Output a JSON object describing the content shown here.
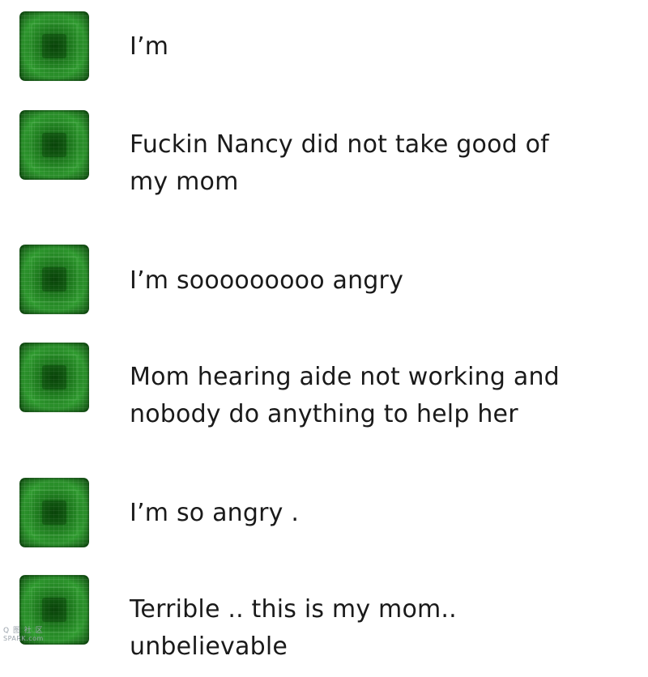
{
  "messages": [
    {
      "avatar_icon": "green-tile-avatar",
      "text": "I’m"
    },
    {
      "avatar_icon": "green-tile-avatar",
      "text": "Fuckin Nancy did not take good of\nmy mom"
    },
    {
      "avatar_icon": "green-tile-avatar",
      "text": "I’m sooooooooo angry"
    },
    {
      "avatar_icon": "green-tile-avatar",
      "text": "Mom hearing aide not working and\nnobody do anything to help her"
    },
    {
      "avatar_icon": "green-tile-avatar",
      "text": "I’m so angry ."
    },
    {
      "avatar_icon": "green-tile-avatar",
      "text": "Terrible .. this is my mom..\nunbelievable"
    }
  ],
  "watermark": {
    "logo_text": "Q 图 社 区",
    "site_text": "SPARK.com"
  },
  "colors": {
    "avatar_green": "#1f7a1f",
    "text": "#1a1a1a",
    "background": "#ffffff"
  }
}
